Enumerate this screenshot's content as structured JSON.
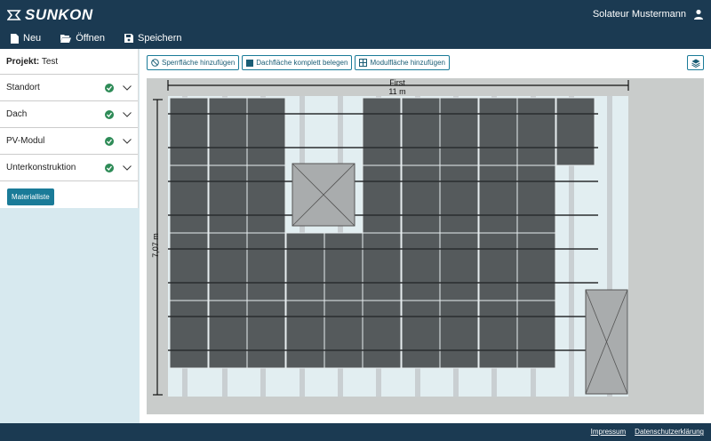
{
  "app": {
    "brand": "SUNKON",
    "user_name": "Solateur Mustermann"
  },
  "menu": {
    "new": "Neu",
    "open": "Öffnen",
    "save": "Speichern"
  },
  "sidebar": {
    "project_label": "Projekt:",
    "project_name": "Test",
    "items": [
      {
        "label": "Standort"
      },
      {
        "label": "Dach"
      },
      {
        "label": "PV-Modul"
      },
      {
        "label": "Unterkonstruktion"
      }
    ],
    "material_button": "Materialliste"
  },
  "toolbar": {
    "add_exclusion": "Sperrfläche hinzufügen",
    "fill_roof": "Dachfläche komplett belegen",
    "add_module_area": "Modulfläche hinzufügen"
  },
  "roof": {
    "ridge_label": "First",
    "width": "11 m",
    "height": "7,07 m"
  },
  "footer": {
    "imprint": "Impressum",
    "privacy": "Datenschutzerklärung"
  },
  "colors": {
    "header": "#1b3a52",
    "accent": "#1a7b98",
    "check": "#2e8b57",
    "module": "#555a5c",
    "roof": "#e2eef1"
  }
}
